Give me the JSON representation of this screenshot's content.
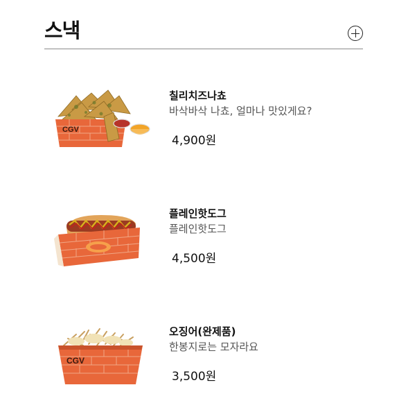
{
  "section": {
    "title": "스낵",
    "more_icon": "plus-circle-icon"
  },
  "products": [
    {
      "name": "칠리치즈나쵸",
      "description": "바삭바삭 나쵸, 얼마나 맛있게요?",
      "price": "4,900원",
      "image_icon": "nachos-image",
      "box_logo": "CGV"
    },
    {
      "name": "플레인핫도그",
      "description": "플레인핫도그",
      "price": "4,500원",
      "image_icon": "hotdog-image"
    },
    {
      "name": "오징어(완제품)",
      "description": "한봉지로는 모자라요",
      "price": "3,500원",
      "image_icon": "squid-image",
      "box_logo": "CGV"
    }
  ],
  "colors": {
    "box_orange": "#e8673a",
    "brick_line": "#f3b89a",
    "divider": "#8a8a8a",
    "desc_text": "#555555"
  }
}
